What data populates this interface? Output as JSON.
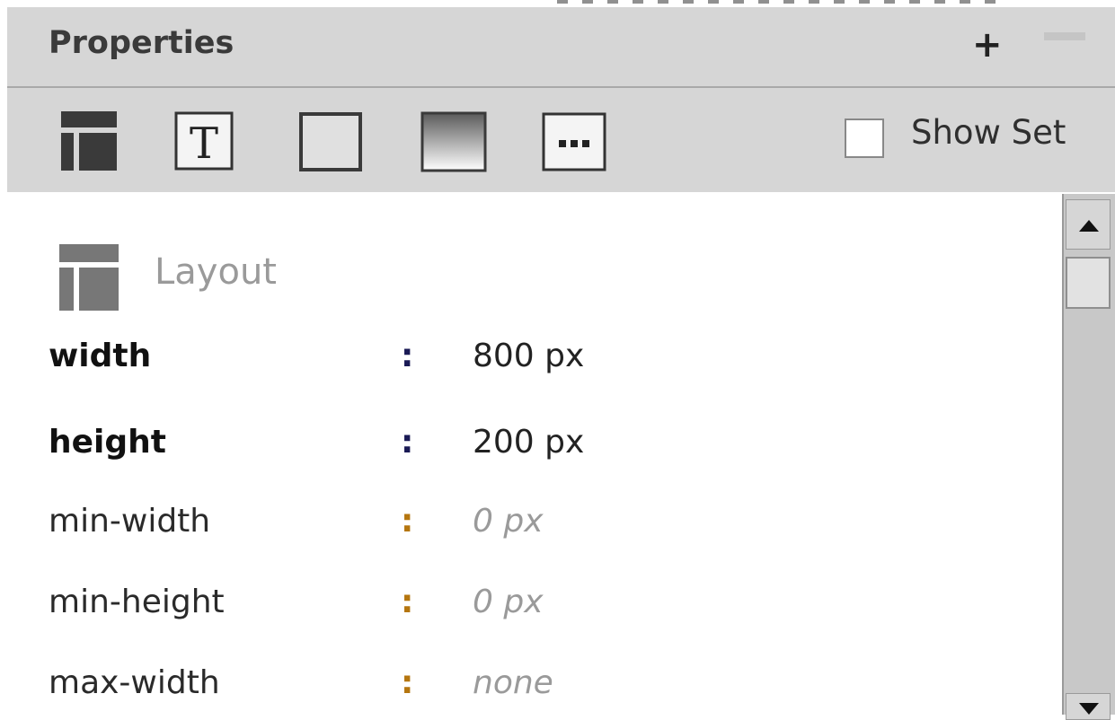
{
  "panel": {
    "title": "Properties",
    "add_icon": "plus-icon",
    "collapse_icon": "minus-icon"
  },
  "toolbar": {
    "categories": [
      {
        "name": "layout",
        "icon": "layout-icon"
      },
      {
        "name": "text",
        "icon": "text-icon"
      },
      {
        "name": "border",
        "icon": "border-icon"
      },
      {
        "name": "background",
        "icon": "background-icon"
      },
      {
        "name": "more",
        "icon": "more-icon"
      }
    ],
    "show_set": {
      "label": "Show Set",
      "checked": false
    }
  },
  "section": {
    "title": "Layout",
    "icon": "layout-icon",
    "properties": [
      {
        "name": "width",
        "colon": ":",
        "value": "800 px",
        "set": true
      },
      {
        "name": "height",
        "colon": ":",
        "value": "200 px",
        "set": true
      },
      {
        "name": "min-width",
        "colon": ":",
        "value": "0 px",
        "set": false
      },
      {
        "name": "min-height",
        "colon": ":",
        "value": "0 px",
        "set": false
      },
      {
        "name": "max-width",
        "colon": ":",
        "value": "none",
        "set": false
      }
    ]
  },
  "colors": {
    "panel_bg": "#d6d6d6",
    "colon_set": "#1a1a55",
    "colon_unset": "#b5760f",
    "value_unset": "#9a9a9a"
  }
}
